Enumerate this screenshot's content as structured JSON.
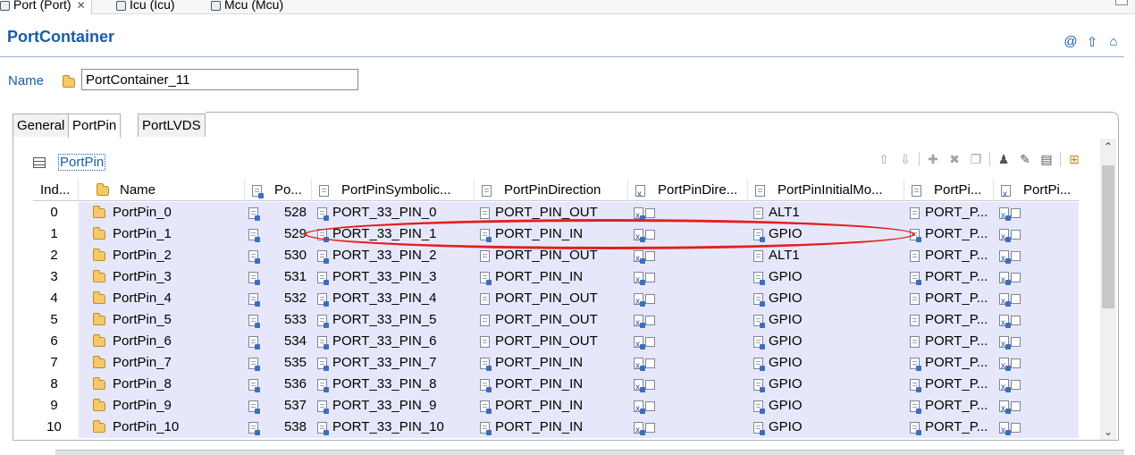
{
  "editor_tabs": [
    {
      "label": "Port (Port)",
      "active": true
    },
    {
      "label": "Icu (Icu)",
      "active": false
    },
    {
      "label": "Mcu (Mcu)",
      "active": false
    }
  ],
  "header": {
    "title": "PortContainer",
    "icons": [
      "at-icon",
      "arrow-up-icon",
      "home-icon"
    ]
  },
  "name_field": {
    "label": "Name",
    "value": "PortContainer_11"
  },
  "section_tabs": [
    "General",
    "PortPin",
    "PortLVDS"
  ],
  "section": {
    "title": "PortPin"
  },
  "toolbar_icons": [
    "move-up-icon",
    "move-down-icon",
    "add-icon",
    "delete-icon",
    "copy-icon",
    "user-icon",
    "edit-icon",
    "edit-table-icon",
    "export-icon"
  ],
  "table": {
    "columns": [
      "Ind...",
      "Name",
      "Po...",
      "PortPinSymbolic...",
      "PortPinDirection",
      "PortPinDire...",
      "PortPinInitialMo...",
      "PortPi...",
      "PortPi..."
    ],
    "rows": [
      {
        "index": "0",
        "name": "PortPin_0",
        "po": "528",
        "symbolic": "PORT_33_PIN_0",
        "direction": "PORT_PIN_OUT",
        "mode": "ALT1",
        "portpi": "PORT_P..."
      },
      {
        "index": "1",
        "name": "PortPin_1",
        "po": "529",
        "symbolic": "PORT_33_PIN_1",
        "direction": "PORT_PIN_IN",
        "mode": "GPIO",
        "portpi": "PORT_P..."
      },
      {
        "index": "2",
        "name": "PortPin_2",
        "po": "530",
        "symbolic": "PORT_33_PIN_2",
        "direction": "PORT_PIN_OUT",
        "mode": "ALT1",
        "portpi": "PORT_P..."
      },
      {
        "index": "3",
        "name": "PortPin_3",
        "po": "531",
        "symbolic": "PORT_33_PIN_3",
        "direction": "PORT_PIN_IN",
        "mode": "GPIO",
        "portpi": "PORT_P..."
      },
      {
        "index": "4",
        "name": "PortPin_4",
        "po": "532",
        "symbolic": "PORT_33_PIN_4",
        "direction": "PORT_PIN_OUT",
        "mode": "GPIO",
        "portpi": "PORT_P..."
      },
      {
        "index": "5",
        "name": "PortPin_5",
        "po": "533",
        "symbolic": "PORT_33_PIN_5",
        "direction": "PORT_PIN_OUT",
        "mode": "GPIO",
        "portpi": "PORT_P..."
      },
      {
        "index": "6",
        "name": "PortPin_6",
        "po": "534",
        "symbolic": "PORT_33_PIN_6",
        "direction": "PORT_PIN_OUT",
        "mode": "GPIO",
        "portpi": "PORT_P..."
      },
      {
        "index": "7",
        "name": "PortPin_7",
        "po": "535",
        "symbolic": "PORT_33_PIN_7",
        "direction": "PORT_PIN_IN",
        "mode": "GPIO",
        "portpi": "PORT_P..."
      },
      {
        "index": "8",
        "name": "PortPin_8",
        "po": "536",
        "symbolic": "PORT_33_PIN_8",
        "direction": "PORT_PIN_IN",
        "mode": "GPIO",
        "portpi": "PORT_P..."
      },
      {
        "index": "9",
        "name": "PortPin_9",
        "po": "537",
        "symbolic": "PORT_33_PIN_9",
        "direction": "PORT_PIN_IN",
        "mode": "GPIO",
        "portpi": "PORT_P..."
      },
      {
        "index": "10",
        "name": "PortPin_10",
        "po": "538",
        "symbolic": "PORT_33_PIN_10",
        "direction": "PORT_PIN_IN",
        "mode": "GPIO",
        "portpi": "PORT_P..."
      }
    ]
  },
  "colors": {
    "accent": "#1b5ca8",
    "row_fill": "#e7e7fb",
    "annotation": "#e2201c"
  }
}
